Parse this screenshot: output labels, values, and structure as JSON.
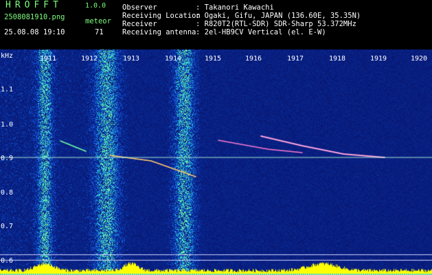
{
  "app": {
    "logo": "HROFFT",
    "version": "1.0.0",
    "filename": "2508081910.png",
    "timestamp": "25.08.08 19:10",
    "meteor_label": "meteor",
    "meteor_count": "71"
  },
  "info": [
    {
      "label": "Observer",
      "value": ": Takanori Kawachi"
    },
    {
      "label": "Receiving Location",
      "value": ": Ogaki, Gifu, JAPAN (136.60E, 35.35N)"
    },
    {
      "label": "Receiver",
      "value": ": R820T2(RTL-SDR) SDR-Sharp 53.372MHz"
    },
    {
      "label": "Receiving antenna",
      "value": ": 2el-HB9CV Vertical (el. E-W)"
    }
  ],
  "axis": {
    "unit": "kHz",
    "hours": [
      "1911",
      "1912",
      "1913",
      "1914",
      "1915",
      "1916",
      "1917",
      "1918",
      "1919",
      "1920"
    ],
    "freq_ticks": [
      "1.1",
      "1.0",
      "0.9",
      "0.8",
      "0.7",
      "0.6"
    ]
  },
  "colors": {
    "background": "#000000",
    "spectrogram_base": "#0a1a8c",
    "signal": "#ffff00",
    "header_green": "#7dff7d"
  }
}
